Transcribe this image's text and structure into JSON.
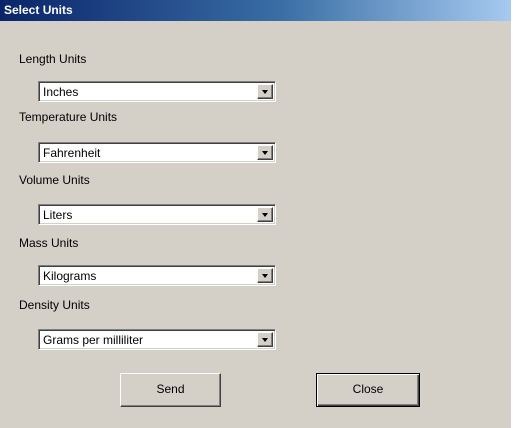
{
  "window": {
    "title": "Select Units"
  },
  "fields": [
    {
      "label": "Length Units",
      "value": "Inches"
    },
    {
      "label": "Temperature Units",
      "value": "Fahrenheit"
    },
    {
      "label": "Volume Units",
      "value": "Liters"
    },
    {
      "label": "Mass Units",
      "value": "Kilograms"
    },
    {
      "label": "Density Units",
      "value": "Grams per milliliter"
    }
  ],
  "buttons": {
    "send": "Send",
    "close": "Close"
  },
  "colors": {
    "face": "#d4d0c8",
    "title_start": "#0a246a",
    "title_end": "#a6caf0"
  }
}
